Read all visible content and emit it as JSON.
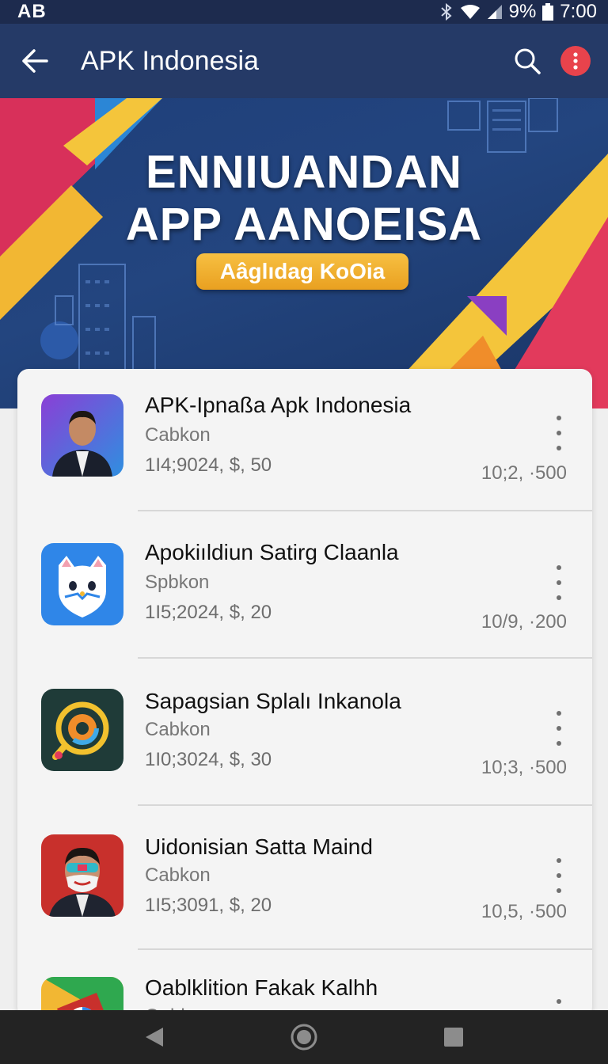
{
  "status_bar": {
    "carrier": "AB",
    "battery": "9%",
    "time": "7:00"
  },
  "app_bar": {
    "title": "APK Indonesia"
  },
  "banner": {
    "title_line1": "ENNIUANDAN",
    "title_line2": "APP AANOEISA",
    "button_label": "Aâglıdag KoOia"
  },
  "apps": [
    {
      "name": "APK-Ipnaßa Apk  Indonesia",
      "publisher": "Cabkon",
      "meta": "1I4;9024,  $, 50",
      "count": "10;2, ·500",
      "icon": "man-portrait-icon"
    },
    {
      "name": "Apokiıldiun Satirg Claanla",
      "publisher": "Spbkon",
      "meta": "1I5;2024,  $, 20",
      "count": "10/9, ·200",
      "icon": "white-cat-icon"
    },
    {
      "name": "Sapagsian Splalı Inkanola",
      "publisher": "Cabkon",
      "meta": "1I0;3024,  $, 30",
      "count": "10;3, ·500",
      "icon": "magnifier-ring-icon"
    },
    {
      "name": "Uidonisian  Satta Maind",
      "publisher": "Cabkon",
      "meta": "1I5;3091,  $, 20",
      "count": "10,5, ·500",
      "icon": "masked-man-icon"
    },
    {
      "name": "Oablklition Fakak Kalhh",
      "publisher": "Oabk",
      "meta": "",
      "count": "",
      "icon": "colorful-app-icon"
    }
  ],
  "colors": {
    "app_bar": "#253a67",
    "accent_red": "#e8434c",
    "pill": "#f0ae2c"
  }
}
